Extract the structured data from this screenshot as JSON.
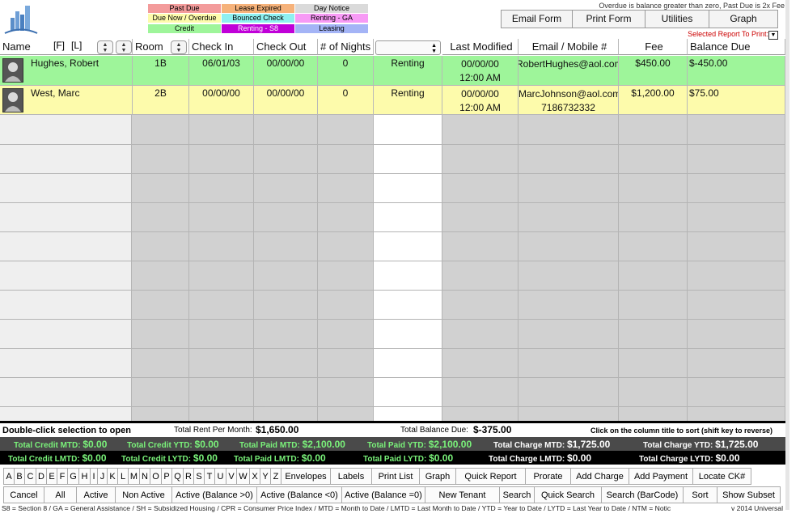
{
  "legend": {
    "past_due": "Past Due",
    "lease_expired": "Lease Expired",
    "day_notice": "Day Notice",
    "due_now": "Due Now / Overdue",
    "bounced_check": "Bounced Check",
    "renting_ga": "Renting - GA",
    "credit": "Credit",
    "renting_s8": "Renting - S8",
    "leasing": "Leasing"
  },
  "notice": "Overdue is balance greater than zero, Past Due is 2x Fee",
  "top_buttons": {
    "email_form": "Email Form",
    "print_form": "Print Form",
    "utilities": "Utilities",
    "graph": "Graph"
  },
  "selected_report_label": "Selected Report To Print:",
  "columns": {
    "name": "Name",
    "first": "[F]",
    "last": "[L]",
    "room": "Room",
    "check_in": "Check In",
    "check_out": "Check Out",
    "nights": "# of Nights",
    "last_modified": "Last Modified",
    "email": "Email / Mobile #",
    "fee": "Fee",
    "balance": "Balance Due"
  },
  "rows": [
    {
      "name": "Hughes, Robert",
      "room": "1B",
      "check_in": "06/01/03",
      "check_out": "00/00/00",
      "nights": "0",
      "status": "Renting",
      "modified_date": "00/00/00",
      "modified_time": "12:00 AM",
      "email": "RobertHughes@aol.com",
      "mobile": "",
      "fee": "$450.00",
      "balance": "$-450.00"
    },
    {
      "name": "West, Marc",
      "room": "2B",
      "check_in": "00/00/00",
      "check_out": "00/00/00",
      "nights": "0",
      "status": "Renting",
      "modified_date": "00/00/00",
      "modified_time": "12:00 AM",
      "email": "MarcJohnson@aol.com",
      "mobile": "7186732332",
      "fee": "$1,200.00",
      "balance": "$75.00"
    }
  ],
  "footer": {
    "hint_open": "Double-click selection to open",
    "rent_label": "Total Rent Per Month:",
    "rent_value": "$1,650.00",
    "balance_label": "Total Balance Due:",
    "balance_value": "$-375.00",
    "sort_hint": "Click on the column title to sort (shift key to reverse)"
  },
  "stats_row1": [
    {
      "label": "Total Credit MTD:",
      "value": "$0.00"
    },
    {
      "label": "Total Credit YTD:",
      "value": "$0.00"
    },
    {
      "label": "Total Paid MTD:",
      "value": "$2,100.00"
    },
    {
      "label": "Total Paid YTD:",
      "value": "$2,100.00"
    },
    {
      "label": "Total Charge MTD:",
      "value": "$1,725.00"
    },
    {
      "label": "Total Charge YTD:",
      "value": "$1,725.00"
    }
  ],
  "stats_row2": [
    {
      "label": "Total Credit LMTD:",
      "value": "$0.00"
    },
    {
      "label": "Total Credit LYTD:",
      "value": "$0.00"
    },
    {
      "label": "Total Paid LMTD:",
      "value": "$0.00"
    },
    {
      "label": "Total Paid LYTD:",
      "value": "$0.00"
    },
    {
      "label": "Total Charge LMTD:",
      "value": "$0.00"
    },
    {
      "label": "Total Charge LYTD:",
      "value": "$0.00"
    }
  ],
  "letters": [
    "A",
    "B",
    "C",
    "D",
    "E",
    "F",
    "G",
    "H",
    "I",
    "J",
    "K",
    "L",
    "M",
    "N",
    "O",
    "P",
    "Q",
    "R",
    "S",
    "T",
    "U",
    "V",
    "W",
    "X",
    "Y",
    "Z"
  ],
  "toolbar1": [
    "Envelopes",
    "Labels",
    "Print List",
    "Graph",
    "Quick Report",
    "Prorate",
    "Add Charge",
    "Add Payment",
    "Locate CK#"
  ],
  "toolbar2": [
    "Cancel",
    "All",
    "Active",
    "Non Active",
    "Active (Balance >0)",
    "Active (Balance <0)",
    "Active (Balance =0)",
    "New Tenant",
    "Search",
    "Quick Search",
    "Search (BarCode)",
    "Sort",
    "Show Subset"
  ],
  "abbreviations": "S8 = Section 8  /  GA = General Assistance  /  SH = Subsidized Housing  /  CPR = Consumer Price Index  /  MTD = Month to Date  /  LMTD = Last Month to Date  /  YTD = Year to Date  /  LYTD = Last Year to Date  /  NTM = Notic",
  "version": "v 2014 Universal",
  "colors": {
    "green_row": "#9ef59a",
    "yellow_row": "#fdfbab",
    "accent_red": "#cc0000"
  }
}
